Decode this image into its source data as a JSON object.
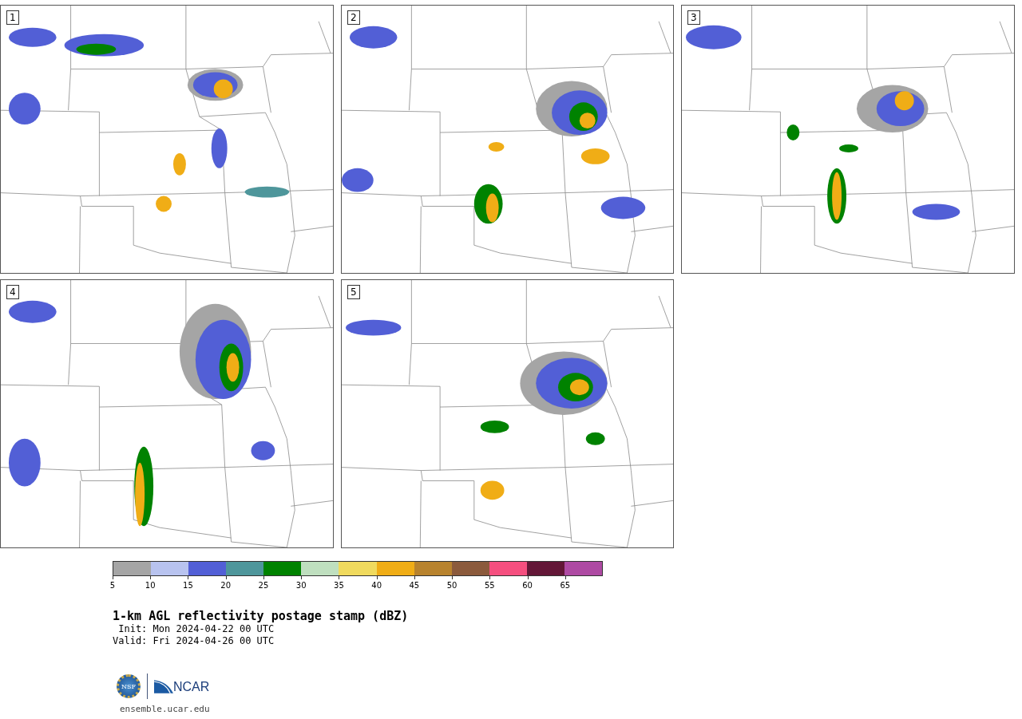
{
  "panels": [
    {
      "label": "1"
    },
    {
      "label": "2"
    },
    {
      "label": "3"
    },
    {
      "label": "4"
    },
    {
      "label": "5"
    }
  ],
  "colorbar": {
    "segments": [
      {
        "color": "#a5a5a5"
      },
      {
        "color": "#b8c3ef"
      },
      {
        "color": "#525fd6"
      },
      {
        "color": "#4e969b"
      },
      {
        "color": "#008200"
      },
      {
        "color": "#bfdfbf"
      },
      {
        "color": "#f0da5e"
      },
      {
        "color": "#f0ad16"
      },
      {
        "color": "#b8832e"
      },
      {
        "color": "#8b5a3c"
      },
      {
        "color": "#f54f7f"
      },
      {
        "color": "#631737"
      },
      {
        "color": "#ae4aa3"
      }
    ],
    "ticks": [
      "5",
      "10",
      "15",
      "20",
      "25",
      "30",
      "35",
      "40",
      "45",
      "50",
      "55",
      "60",
      "65"
    ]
  },
  "title": "1-km AGL reflectivity postage stamp (dBZ)",
  "init": " Init: Mon 2024-04-22 00 UTC",
  "valid": "Valid: Fri 2024-04-26 00 UTC",
  "logos": {
    "nsf": "NSF",
    "ncar": "NCAR"
  },
  "url": "ensemble.ucar.edu"
}
